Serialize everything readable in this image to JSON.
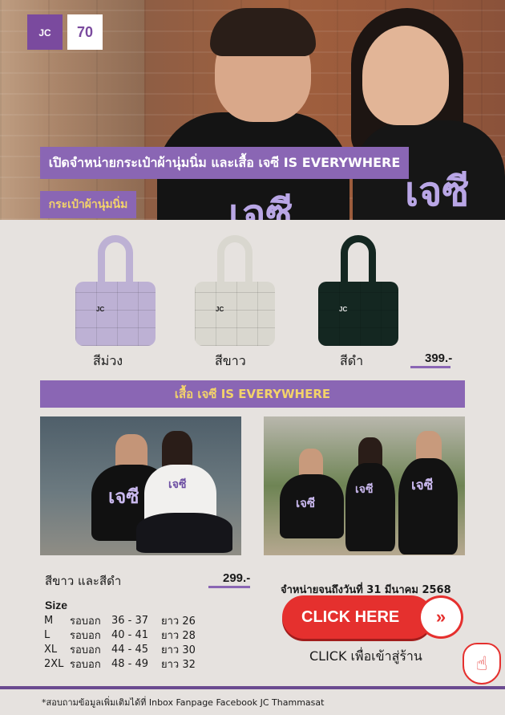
{
  "logos": {
    "jc": "JC",
    "anniversary": "70"
  },
  "header": {
    "title": "เปิดจำหน่ายกระเป๋าผ้านุ่มนิ่ม และเสื้อ เจซี  IS EVERYWHERE",
    "bag_section": "กระเป๋าผ้านุ่มนิ่ม",
    "shirt_print": "เจซี"
  },
  "bags": {
    "items": [
      {
        "label": "สีม่วง",
        "mark": "JC",
        "color": "#bdb1d4"
      },
      {
        "label": "สีขาว",
        "mark": "JC",
        "color": "#d9d7cf"
      },
      {
        "label": "สีดำ",
        "mark": "JC",
        "color": "#142721"
      }
    ],
    "price": "399.-"
  },
  "shirts": {
    "banner": "เสื้อ เจซี IS EVERYWHERE",
    "print": "เจซี",
    "colors": "สีขาว และสีดำ",
    "price": "299.-"
  },
  "sizes": {
    "title": "Size",
    "rows": [
      {
        "size": "M",
        "chest_label": "รอบอก",
        "chest": "36 - 37",
        "length": "ยาว 26"
      },
      {
        "size": "L",
        "chest_label": "รอบอก",
        "chest": "40 - 41",
        "length": "ยาว 28"
      },
      {
        "size": "XL",
        "chest_label": "รอบอก",
        "chest": "44 - 45",
        "length": "ยาว 30"
      },
      {
        "size": "2XL",
        "chest_label": "รอบอก",
        "chest": "48 - 49",
        "length": "ยาว 32"
      }
    ]
  },
  "cta": {
    "deadline": "จำหน่ายจนถึงวันที่ 31 มีนาคม 2568",
    "button": "CLICK HERE",
    "arrow": "»",
    "store_text": "CLICK เพื่อเข้าสู่ร้าน",
    "hand": "☝"
  },
  "footer": {
    "note": "*สอบถามข้อมูลเพิ่มเติมได้ที่ Inbox Fanpage Facebook JC Thammasat"
  },
  "colors": {
    "accent_purple": "#8a66b4",
    "gold": "#f3d36a",
    "cta_red": "#e5302e"
  }
}
